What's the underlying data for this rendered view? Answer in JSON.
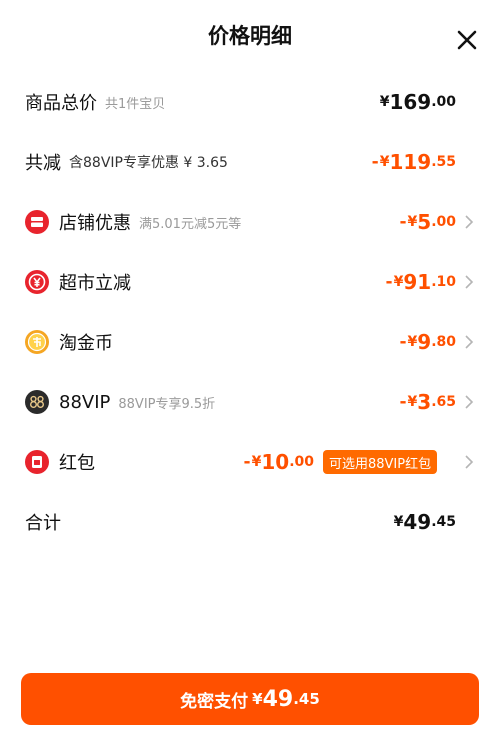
{
  "header": {
    "title": "价格明细"
  },
  "summary": {
    "goods_total": {
      "label": "商品总价",
      "sub": "共1件宝贝",
      "currency": "¥",
      "int": "169",
      "dec": ".00"
    },
    "total_reduce": {
      "label": "共减",
      "sub": "含88VIP专享优惠 ¥ 3.65",
      "sign": "-",
      "currency": "¥",
      "int": "119",
      "dec": ".55"
    }
  },
  "discounts": [
    {
      "label": "店铺优惠",
      "sub": "满5.01元减5元等",
      "sign": "-",
      "currency": "¥",
      "int": "5",
      "dec": ".00",
      "icon": "shop-icon"
    },
    {
      "label": "超市立减",
      "sub": "",
      "sign": "-",
      "currency": "¥",
      "int": "91",
      "dec": ".10",
      "icon": "supermarket-icon"
    },
    {
      "label": "淘金币",
      "sub": "",
      "sign": "-",
      "currency": "¥",
      "int": "9",
      "dec": ".80",
      "icon": "gold-coin-icon"
    },
    {
      "label": "88VIP",
      "sub": "88VIP专享9.5折",
      "sign": "-",
      "currency": "¥",
      "int": "3",
      "dec": ".65",
      "icon": "vip88-icon"
    },
    {
      "label": "红包",
      "sub": "",
      "sign": "-",
      "currency": "¥",
      "int": "10",
      "dec": ".00",
      "icon": "red-packet-icon",
      "tag": "可选用88VIP红包"
    }
  ],
  "total": {
    "label": "合计",
    "currency": "¥",
    "int": "49",
    "dec": ".45"
  },
  "pay_button": {
    "label": "免密支付",
    "currency": "¥",
    "int": "49",
    "dec": ".45"
  },
  "colors": {
    "accent": "#ff5000",
    "tag_bg": "#ff6a00",
    "icon_red": "#e8242d",
    "coin": "#f5a623",
    "vip_bg": "#2b2b2b"
  }
}
